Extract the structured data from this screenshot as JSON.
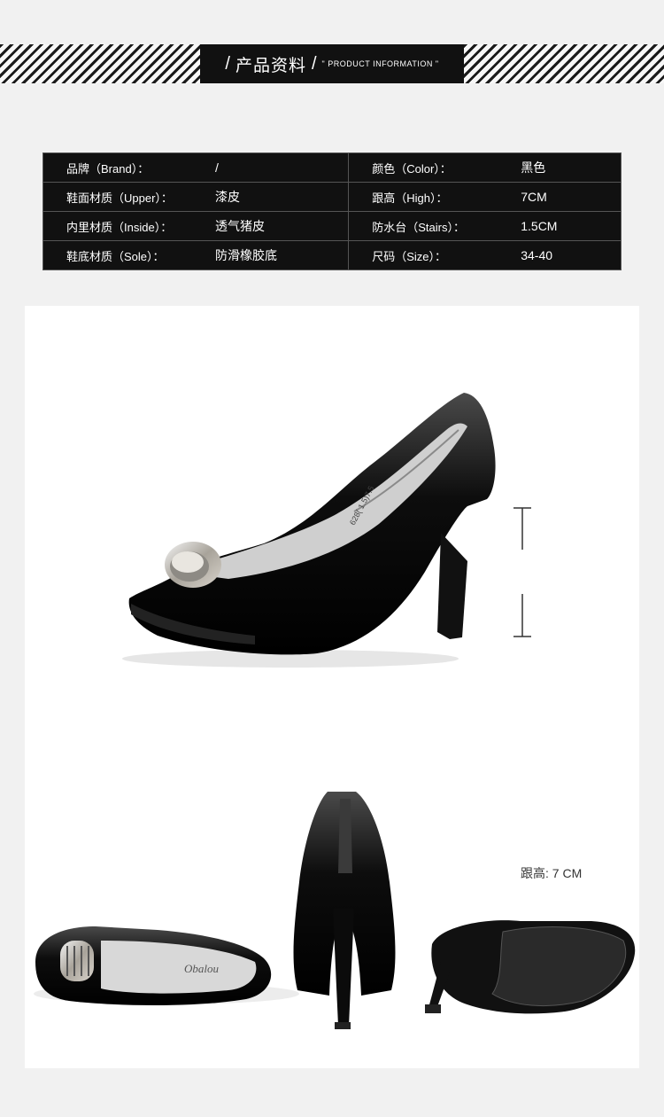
{
  "header": {
    "slash": "/",
    "title_zh": "产品资料",
    "slash2": "/",
    "title_en": "\" PRODUCT INFORMATION \""
  },
  "specs": [
    {
      "label": "品牌（Brand）：",
      "value": "/",
      "label2": "颜色（Color）：",
      "value2": "黑色"
    },
    {
      "label": "鞋面材质（Upper）：",
      "value": "漆皮",
      "label2": "跟高（High）：",
      "value2": "7CM"
    },
    {
      "label": "内里材质（Inside）：",
      "value": "透气猪皮",
      "label2": "防水台（Stairs）：",
      "value2": "1.5CM"
    },
    {
      "label": "鞋底材质（Sole）：",
      "value": "防滑橡胶底",
      "label2": "尺码（Size）：",
      "value2": "34-40"
    }
  ],
  "heel_measure": {
    "label": "跟高:",
    "value": "7 CM"
  },
  "insole_text": "628( 1.5)7.5",
  "insole_logo": "Obalou"
}
